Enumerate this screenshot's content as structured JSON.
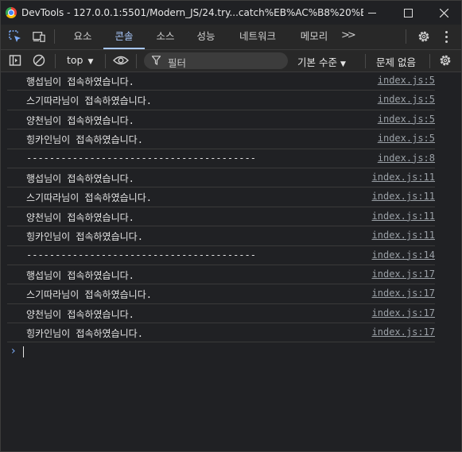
{
  "window": {
    "title": "DevTools - 127.0.0.1:5501/Modern_JS/24.try...catch%EB%AC%B8%20%ED%..."
  },
  "tabs": [
    {
      "label": "요소"
    },
    {
      "label": "콘솔",
      "active": true
    },
    {
      "label": "소스"
    },
    {
      "label": "성능"
    },
    {
      "label": "네트워크"
    },
    {
      "label": "메모리"
    }
  ],
  "toolbar": {
    "context": "top",
    "filter_placeholder": "필터",
    "levels": "기본 수준",
    "issues": "문제 없음"
  },
  "console": {
    "rows": [
      {
        "message": "행섭님이 접속하였습니다.",
        "source": "index.js:5"
      },
      {
        "message": "스기따라님이 접속하였습니다.",
        "source": "index.js:5"
      },
      {
        "message": "양천님이 접속하였습니다.",
        "source": "index.js:5"
      },
      {
        "message": "힝카인님이 접속하였습니다.",
        "source": "index.js:5"
      },
      {
        "message": "----------------------------------------",
        "source": "index.js:8"
      },
      {
        "message": "행섭님이 접속하였습니다.",
        "source": "index.js:11"
      },
      {
        "message": "스기따라님이 접속하였습니다.",
        "source": "index.js:11"
      },
      {
        "message": "양천님이 접속하였습니다.",
        "source": "index.js:11"
      },
      {
        "message": "힝카인님이 접속하였습니다.",
        "source": "index.js:11"
      },
      {
        "message": "----------------------------------------",
        "source": "index.js:14"
      },
      {
        "message": "행섭님이 접속하였습니다.",
        "source": "index.js:17"
      },
      {
        "message": "스기따라님이 접속하였습니다.",
        "source": "index.js:17"
      },
      {
        "message": "양천님이 접속하였습니다.",
        "source": "index.js:17"
      },
      {
        "message": "힝카인님이 접속하였습니다.",
        "source": "index.js:17"
      }
    ]
  }
}
